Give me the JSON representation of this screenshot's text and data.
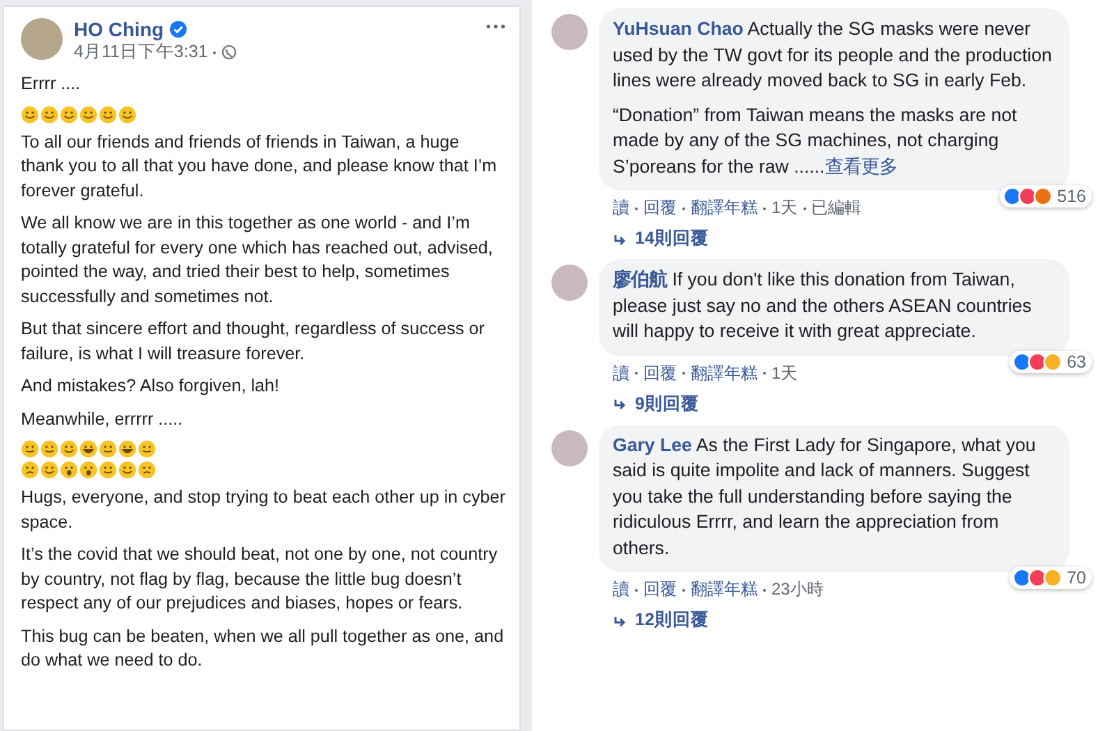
{
  "post": {
    "author": "HO Ching",
    "verified": true,
    "time": "4月11日下午3:31",
    "blocks": [
      {
        "kind": "text",
        "text": "Errrr ...."
      },
      {
        "kind": "emoji",
        "emoji": [
          {
            "kind": "smile"
          },
          {
            "kind": "smile"
          },
          {
            "kind": "smile"
          },
          {
            "kind": "smile"
          },
          {
            "kind": "smile"
          },
          {
            "kind": "smile"
          }
        ]
      },
      {
        "kind": "text",
        "text": "To all our friends and friends of friends in Taiwan, a huge thank you to all that you have done, and please know that I’m forever grateful."
      },
      {
        "kind": "text",
        "text": "We all know we are in this together as one world - and I’m totally grateful for every one which has reached out, advised, pointed the way, and tried their best to help, sometimes successfully and sometimes not."
      },
      {
        "kind": "text",
        "text": "But that sincere effort and thought, regardless of success or failure, is what I will treasure forever."
      },
      {
        "kind": "text",
        "text": "And mistakes? Also forgiven, lah!"
      },
      {
        "kind": "text",
        "text": "Meanwhile, errrrr ....."
      },
      {
        "kind": "emoji",
        "emoji": [
          {
            "kind": "grin"
          },
          {
            "kind": "grin"
          },
          {
            "kind": "smile"
          },
          {
            "kind": "laugh"
          },
          {
            "kind": "grin"
          },
          {
            "kind": "laugh"
          },
          {
            "kind": "grin"
          }
        ]
      },
      {
        "kind": "emoji",
        "emoji": [
          {
            "kind": "sad"
          },
          {
            "kind": "smile"
          },
          {
            "kind": "wow"
          },
          {
            "kind": "wow"
          },
          {
            "kind": "grin"
          },
          {
            "kind": "smile"
          },
          {
            "kind": "sad"
          }
        ]
      },
      {
        "kind": "text",
        "text": "Hugs, everyone, and stop trying to beat each other up in cyber space."
      },
      {
        "kind": "text",
        "text": "It’s the covid that we should beat, not one by one, not country by country, not flag by flag, because the little bug doesn’t respect any of our prejudices and biases, hopes or fears."
      },
      {
        "kind": "text",
        "text": "This bug can be beaten, when we all pull together as one, and do what we need to do."
      }
    ]
  },
  "comments": [
    {
      "author": "YuHsuan Chao",
      "paragraphs": [
        "Actually the SG masks were never used by the TW govt for its people and the production lines were already moved back to SG in early Feb.",
        "“Donation” from Taiwan means the masks are not made by any of the SG machines, not charging S’poreans for the raw ......"
      ],
      "see_more": "查看更多",
      "reactions": [
        {
          "kind": "like"
        },
        {
          "kind": "love"
        },
        {
          "kind": "angry"
        }
      ],
      "reaction_count": "516",
      "actions": [
        "讀",
        "回覆",
        "翻譯年糕",
        "1天",
        "已編輯"
      ],
      "replies": "14則回覆"
    },
    {
      "author": "廖伯航",
      "paragraphs": [
        "If you don't like this donation from Taiwan, please just say no and the others ASEAN countries will happy to receive it with great appreciate."
      ],
      "reactions": [
        {
          "kind": "like"
        },
        {
          "kind": "love"
        },
        {
          "kind": "haha"
        }
      ],
      "reaction_count": "63",
      "actions": [
        "讀",
        "回覆",
        "翻譯年糕",
        "1天"
      ],
      "replies": "9則回覆"
    },
    {
      "author": "Gary Lee",
      "paragraphs": [
        "As the First Lady for Singapore, what you said is quite impolite and lack of manners. Suggest you take the full understanding before saying the ridiculous Errrr, and learn the appreciation from others."
      ],
      "reactions": [
        {
          "kind": "like"
        },
        {
          "kind": "love"
        },
        {
          "kind": "haha"
        }
      ],
      "reaction_count": "70",
      "actions": [
        "讀",
        "回覆",
        "翻譯年糕",
        "23小時"
      ],
      "replies": "12則回覆"
    }
  ]
}
